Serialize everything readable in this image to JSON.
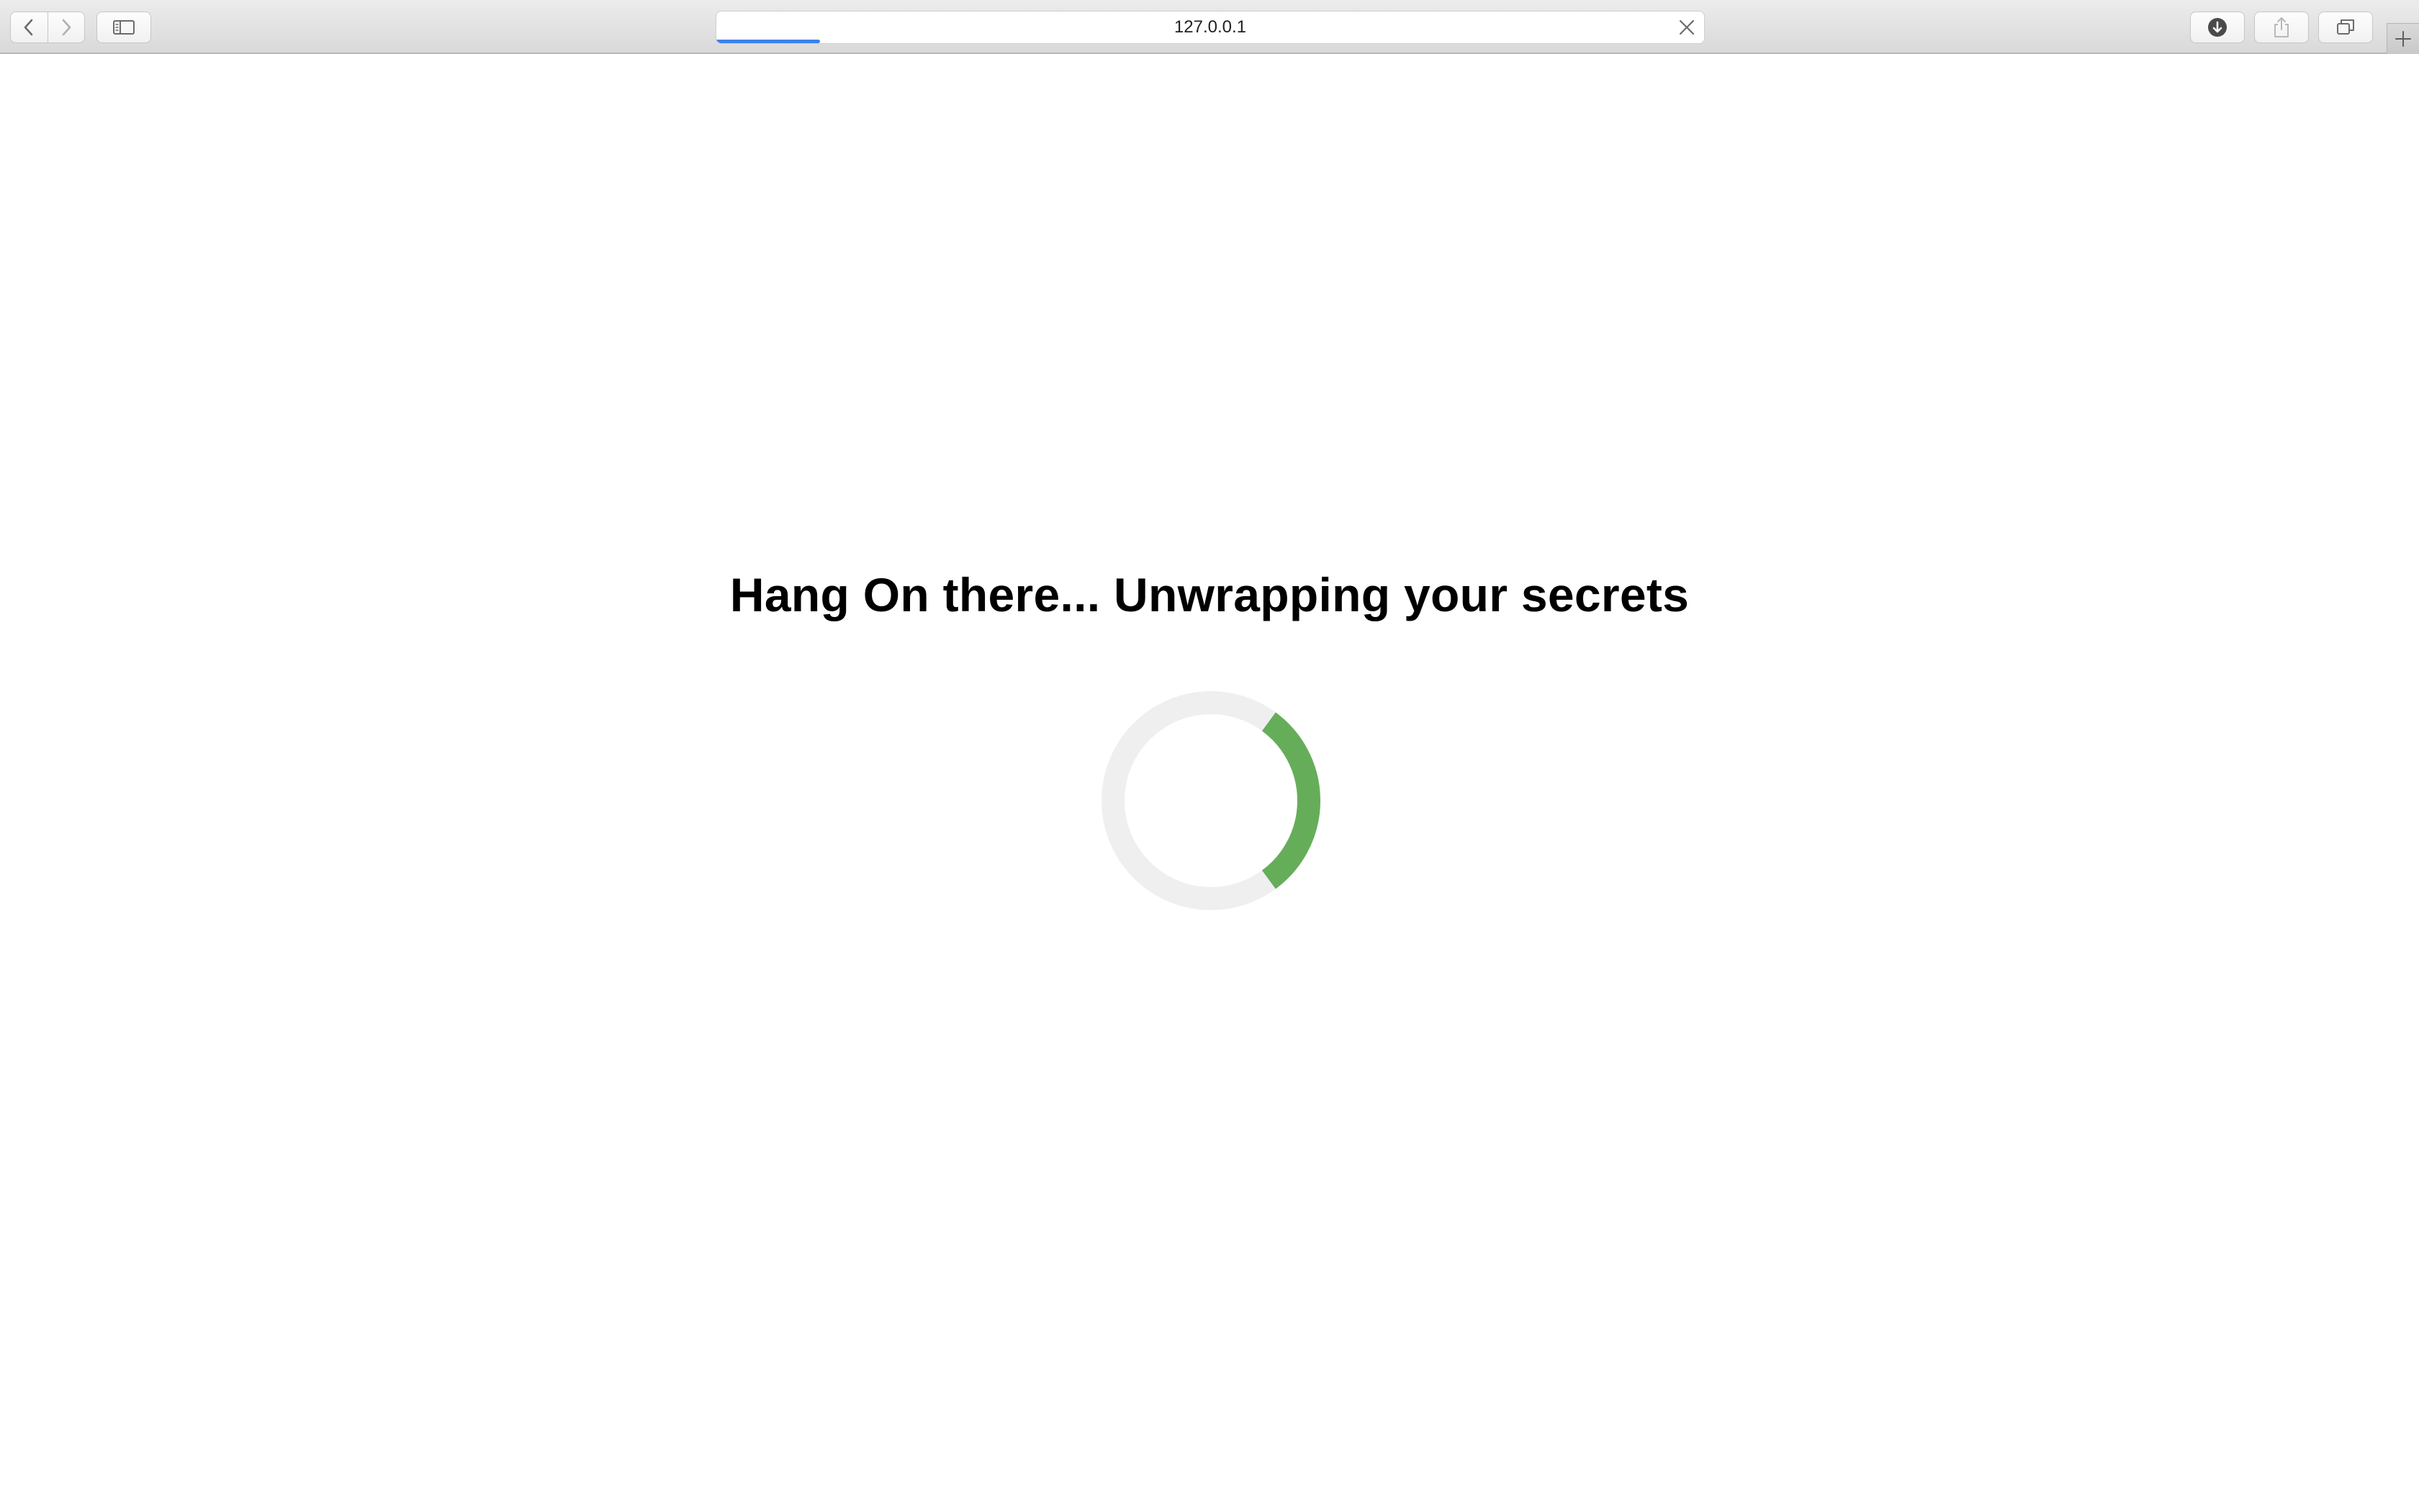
{
  "browser": {
    "url": "127.0.0.1",
    "load_progress": 0.105,
    "progress_color": "#3b82e8",
    "icons": {
      "back": "chevron-left-icon",
      "forward": "chevron-right-icon",
      "sidebar": "sidebar-icon",
      "stop": "close-icon",
      "downloads": "download-icon",
      "share": "share-icon",
      "tabs": "tabs-icon",
      "new_tab": "plus-icon"
    }
  },
  "page": {
    "heading": "Hang On there... Unwrapping your secrets",
    "spinner": {
      "track_color": "#efefef",
      "arc_color": "#66ad5a"
    }
  }
}
